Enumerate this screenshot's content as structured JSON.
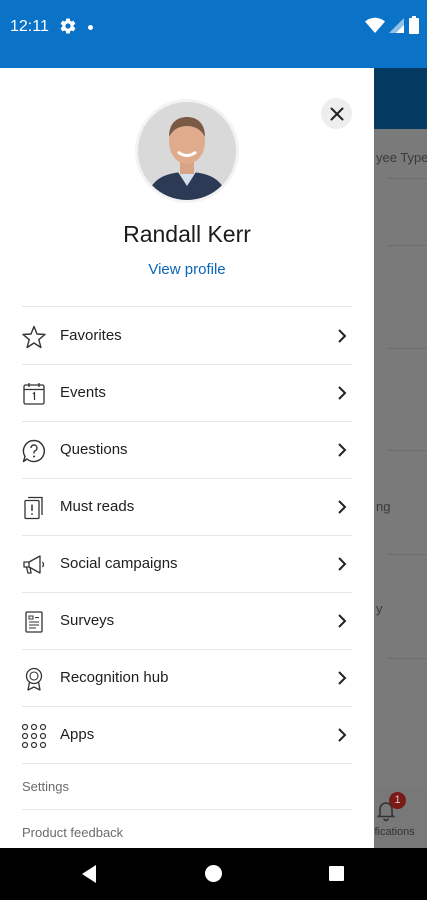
{
  "status_bar": {
    "time": "12:11"
  },
  "background_app": {
    "column_header": "yee Type",
    "row_text_1": "ng",
    "row_text_2": "y",
    "notifications_badge": "1",
    "notifications_label": "ifications"
  },
  "drawer": {
    "profile": {
      "name": "Randall Kerr",
      "view_profile": "View profile"
    },
    "menu": [
      {
        "label": "Favorites",
        "icon": "star-icon"
      },
      {
        "label": "Events",
        "icon": "calendar-icon"
      },
      {
        "label": "Questions",
        "icon": "question-icon"
      },
      {
        "label": "Must reads",
        "icon": "must-read-icon"
      },
      {
        "label": "Social campaigns",
        "icon": "megaphone-icon"
      },
      {
        "label": "Surveys",
        "icon": "survey-icon"
      },
      {
        "label": "Recognition hub",
        "icon": "award-icon"
      },
      {
        "label": "Apps",
        "icon": "apps-grid-icon"
      }
    ],
    "settings_label": "Settings",
    "feedback_label": "Product feedback"
  },
  "colors": {
    "status_bar": "#0a73c8",
    "link": "#0a66b9",
    "scrim_header": "#053a63"
  }
}
